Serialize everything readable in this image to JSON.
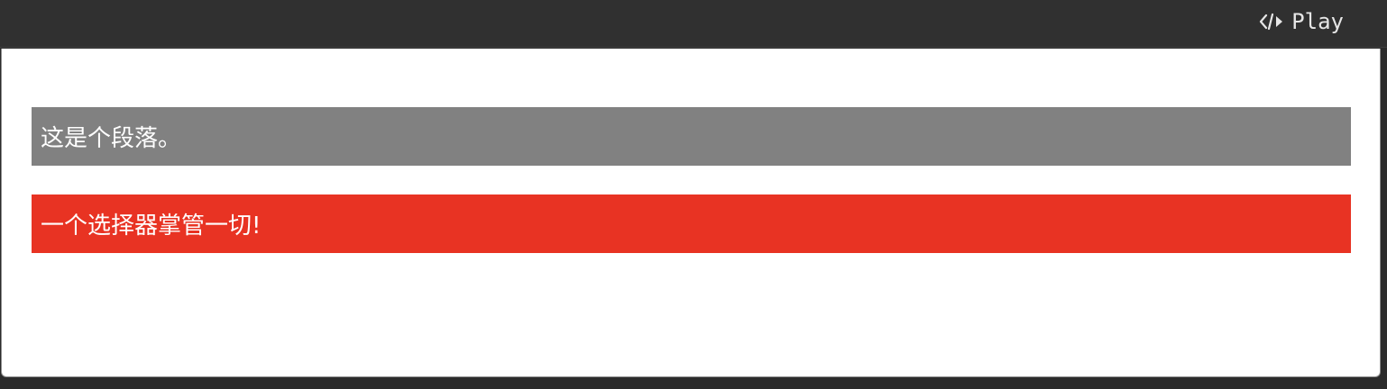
{
  "toolbar": {
    "play_label": "Play",
    "play_icon": "code-icon"
  },
  "output": {
    "paragraph_1": "这是个段落。",
    "paragraph_2": "一个选择器掌管一切!",
    "paragraph_1_bg": "#818181",
    "paragraph_2_bg": "#e83323"
  }
}
